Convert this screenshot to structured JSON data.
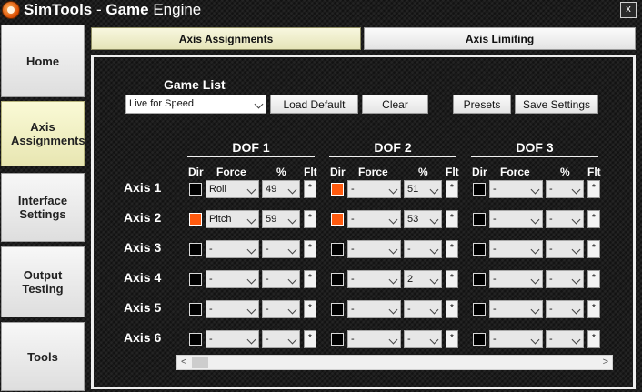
{
  "window": {
    "title_a": "SimTools",
    "title_sep": " - ",
    "title_b": "Game",
    "title_c": " Engine",
    "close": "x"
  },
  "nav": [
    {
      "label": "Home"
    },
    {
      "label": "Axis Assignments"
    },
    {
      "label": "Interface Settings"
    },
    {
      "label": "Output Testing"
    },
    {
      "label": "Tools"
    }
  ],
  "tabs": [
    {
      "label": "Axis Assignments"
    },
    {
      "label": "Axis Limiting"
    }
  ],
  "game_list": {
    "label": "Game List",
    "selected": "Live for Speed"
  },
  "buttons": {
    "load_default": "Load Default",
    "clear": "Clear",
    "presets": "Presets",
    "save_settings": "Save Settings"
  },
  "dofs": [
    {
      "title": "DOF 1"
    },
    {
      "title": "DOF 2"
    },
    {
      "title": "DOF 3"
    }
  ],
  "columns": {
    "dir": "Dir",
    "force": "Force",
    "pct": "%",
    "flt": "Flt"
  },
  "flt_mark": "*",
  "axes": [
    {
      "label": "Axis 1",
      "cells": [
        {
          "dir_on": false,
          "force": "Roll",
          "pct": "49"
        },
        {
          "dir_on": true,
          "force": "-",
          "pct": "51"
        },
        {
          "dir_on": false,
          "force": "-",
          "pct": "-"
        }
      ]
    },
    {
      "label": "Axis 2",
      "cells": [
        {
          "dir_on": true,
          "force": "Pitch",
          "pct": "59"
        },
        {
          "dir_on": true,
          "force": "-",
          "pct": "53"
        },
        {
          "dir_on": false,
          "force": "-",
          "pct": "-"
        }
      ]
    },
    {
      "label": "Axis 3",
      "cells": [
        {
          "dir_on": false,
          "force": "-",
          "pct": "-"
        },
        {
          "dir_on": false,
          "force": "-",
          "pct": "-"
        },
        {
          "dir_on": false,
          "force": "-",
          "pct": "-"
        }
      ]
    },
    {
      "label": "Axis 4",
      "cells": [
        {
          "dir_on": false,
          "force": "-",
          "pct": "-"
        },
        {
          "dir_on": false,
          "force": "-",
          "pct": "2"
        },
        {
          "dir_on": false,
          "force": "-",
          "pct": "-"
        }
      ]
    },
    {
      "label": "Axis 5",
      "cells": [
        {
          "dir_on": false,
          "force": "-",
          "pct": "-"
        },
        {
          "dir_on": false,
          "force": "-",
          "pct": "-"
        },
        {
          "dir_on": false,
          "force": "-",
          "pct": "-"
        }
      ]
    },
    {
      "label": "Axis 6",
      "cells": [
        {
          "dir_on": false,
          "force": "-",
          "pct": "-"
        },
        {
          "dir_on": false,
          "force": "-",
          "pct": "-"
        },
        {
          "dir_on": false,
          "force": "-",
          "pct": "-"
        }
      ]
    }
  ],
  "colors": {
    "accent_on": "#ff5a0f",
    "active_tab": "#f8f7df"
  }
}
